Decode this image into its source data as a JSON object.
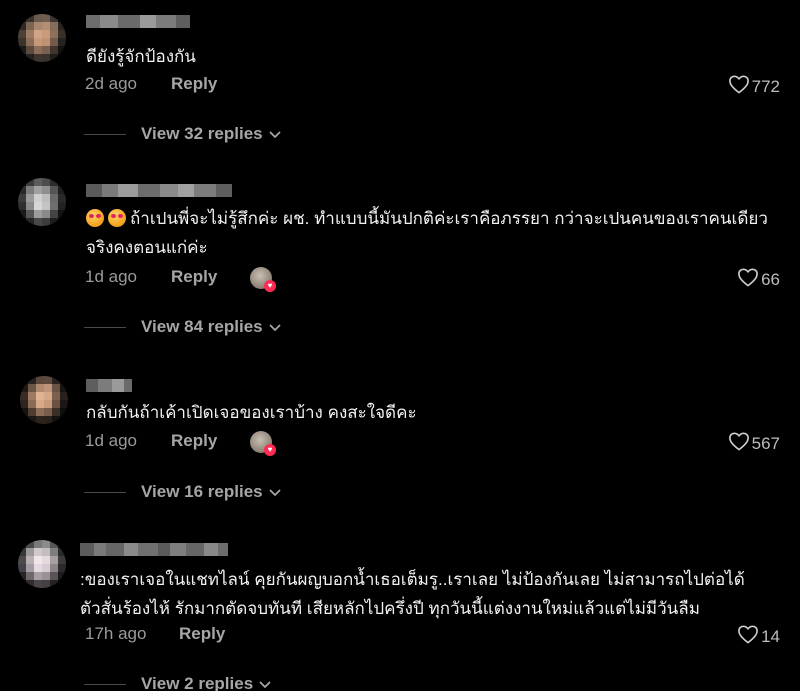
{
  "comments": [
    {
      "avatar_colors": [
        "#1a1a1a",
        "#3a332e",
        "#6b5a4e",
        "#6f5d50",
        "#3d3632",
        "#141414",
        "#2e2926",
        "#7c6555",
        "#a8876e",
        "#b48f72",
        "#866c5a",
        "#2b2522",
        "#4d3f36",
        "#9c7b62",
        "#d0a585",
        "#c99b7a",
        "#8d6f5b",
        "#3a302a",
        "#3c332d",
        "#8a6c57",
        "#c7987a",
        "#bf9272",
        "#745a48",
        "#262220",
        "#1c1a18",
        "#5a4a3e",
        "#8b6e5a",
        "#7a604e",
        "#40352e",
        "#121212",
        "#0d0d0d",
        "#26221f",
        "#3e3530",
        "#3a322c",
        "#1f1c1a",
        "#0a0a0a"
      ],
      "username_colors": [
        "#6d6d6d",
        "#8a8a8a",
        "#6a6a6a",
        "#9a9a9a",
        "#7b7b7b",
        "#5e5e5e"
      ],
      "text_lines": [
        "ดียังรู้จักป้องกัน"
      ],
      "has_emoji": false,
      "time": "2d ago",
      "reply_label": "Reply",
      "likes": "772",
      "has_liked_avatar": false,
      "view_replies": "View 32 replies"
    },
    {
      "avatar_colors": [
        "#141414",
        "#3a3a3a",
        "#5c5c5c",
        "#4c4c4c",
        "#2c2c2c",
        "#0f0f0f",
        "#2a2a2a",
        "#7d7d7d",
        "#a0a0a0",
        "#8e8e8e",
        "#555555",
        "#1e1e1e",
        "#3c3c3c",
        "#9a9a9a",
        "#cfcfcf",
        "#bdbdbd",
        "#6a6a6a",
        "#2a2a2a",
        "#2f2f2f",
        "#8a8a8a",
        "#d6d6d6",
        "#c4c4c4",
        "#6e6e6e",
        "#232323",
        "#1a1a1a",
        "#555555",
        "#9c9c9c",
        "#8a8a8a",
        "#444444",
        "#121212",
        "#0b0b0b",
        "#262626",
        "#474747",
        "#3c3c3c",
        "#1d1d1d",
        "#0a0a0a"
      ],
      "username_colors": [
        "#5a5a5a",
        "#7a7a7a",
        "#9b9b9b",
        "#6c6c6c",
        "#8a8a8a",
        "#a0a0a0",
        "#7c7c7c",
        "#5e5e5e"
      ],
      "text_lines": [
        "ถ้าเปนพี่จะไม่รู้สึกค่ะ ผช. ทำแบบนี้มันปกติค่ะเราคือภรรยา กว่าจะเปนคนของเราคนเดียว",
        "จริงคงตอนแก่ค่ะ"
      ],
      "has_emoji": true,
      "time": "1d ago",
      "reply_label": "Reply",
      "likes": "66",
      "has_liked_avatar": true,
      "view_replies": "View 84 replies"
    },
    {
      "avatar_colors": [
        "#0f0f0f",
        "#2c221d",
        "#5a463a",
        "#5e4a3d",
        "#2a221e",
        "#0c0c0c",
        "#1f1815",
        "#6e5646",
        "#b08a70",
        "#c09479",
        "#6a5344",
        "#181412",
        "#392c25",
        "#9e7a62",
        "#e0b493",
        "#d6a887",
        "#7b604e",
        "#2a211c",
        "#2f2520",
        "#8b6b57",
        "#d9aa88",
        "#c99a7a",
        "#6a5242",
        "#1c1714",
        "#17120f",
        "#4d3c31",
        "#8c6d58",
        "#7a5e4c",
        "#3a2e26",
        "#0e0e0e",
        "#0a0a0a",
        "#1c1714",
        "#2c231d",
        "#2a211c",
        "#14110f",
        "#070707"
      ],
      "username_colors": [
        "#5e5e5e",
        "#7c7c7c",
        "#9a9a9a",
        "#6a6a6a"
      ],
      "text_lines": [
        "กลับกันถ้าเค้าเปิดเจอของเราบ้าง คงสะใจดีคะ"
      ],
      "has_emoji": false,
      "time": "1d ago",
      "reply_label": "Reply",
      "likes": "567",
      "has_liked_avatar": true,
      "view_replies": "View 16 replies"
    },
    {
      "avatar_colors": [
        "#1a1a1a",
        "#4a4a4a",
        "#7a7a7a",
        "#8a8a8a",
        "#555555",
        "#1e1e1e",
        "#383838",
        "#9a9a9a",
        "#d0c8cc",
        "#c4bcc0",
        "#7e7e7e",
        "#2a2a2a",
        "#4e4a4c",
        "#b8b0b4",
        "#f0e6ea",
        "#e4dade",
        "#a6a0a2",
        "#3e3a3c",
        "#46424a",
        "#a49ca4",
        "#e6d8e0",
        "#d8ccd4",
        "#8c8488",
        "#2c2a2c",
        "#262426",
        "#6e686c",
        "#a89ea6",
        "#9a9096",
        "#5a5458",
        "#1a1a1a",
        "#0e0e0e",
        "#2e2c2e",
        "#4a4648",
        "#444044",
        "#242224",
        "#0a0a0a"
      ],
      "username_colors": [
        "#5c5c5c",
        "#7a7a7a",
        "#666666",
        "#8a8a8a",
        "#707070",
        "#5a5a5a",
        "#7e7e7e",
        "#666666",
        "#888888",
        "#6c6c6c"
      ],
      "text_lines": [
        ":ของเราเจอในแชทไลน์ คุยกันผญบอกน้ำเธอเต็มรู..เราเลย ไม่ป้องกันเลย ไม่สามารถไปต่อได้",
        "ตัวสั่นร้องไห้ รักมากตัดจบทันที เสียหลักไปครึ่งปี ทุกวันนี้แต่งงานใหม่แล้วแต่ไม่มีวันลืม"
      ],
      "has_emoji": false,
      "time": "17h ago",
      "reply_label": "Reply",
      "likes": "14",
      "has_liked_avatar": false,
      "view_replies": "View 2 replies"
    }
  ],
  "icons": {
    "heart": "heart-outline-icon",
    "chevron": "chevron-down-icon",
    "emoji": "smiling-face-with-heart-eyes-icon"
  }
}
